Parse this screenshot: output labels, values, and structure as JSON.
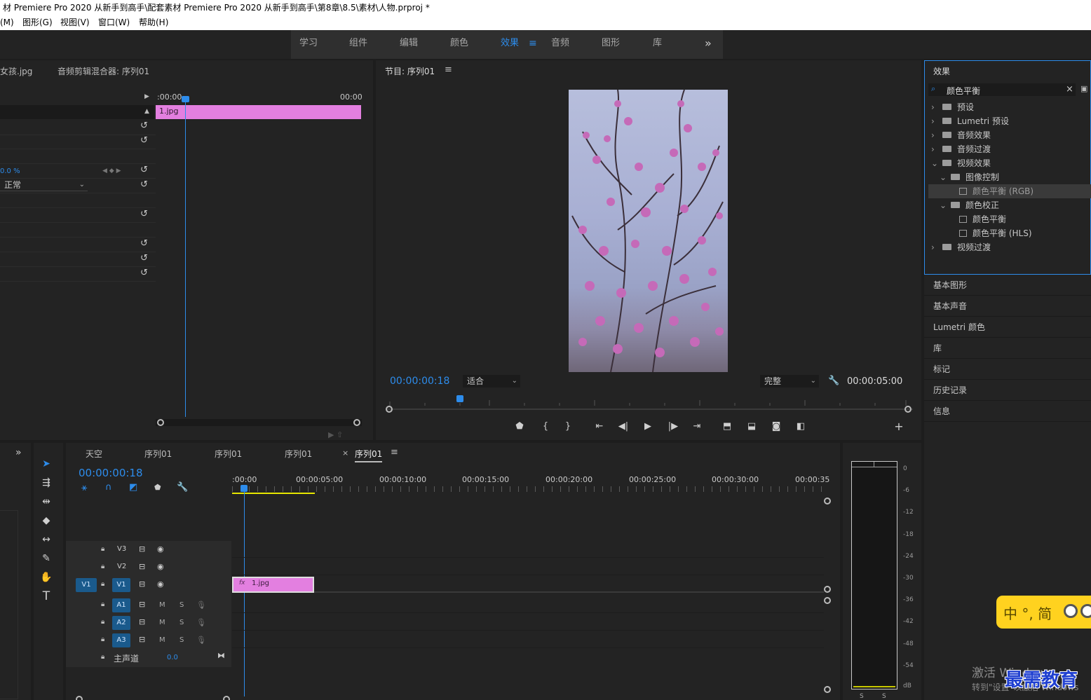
{
  "window": {
    "title": "材 Premiere Pro 2020 从新手到高手\\配套素材 Premiere Pro 2020 从新手到高手\\第8章\\8.5\\素材\\人物.prproj *"
  },
  "menu": [
    "(M)",
    "图形(G)",
    "视图(V)",
    "窗口(W)",
    "帮助(H)"
  ],
  "workspaces": {
    "tabs": [
      "学习",
      "组件",
      "编辑",
      "颜色",
      "效果",
      "音频",
      "图形",
      "库"
    ],
    "active": "效果",
    "overflow": "»"
  },
  "source_panel": {
    "tab_clip": "女孩.jpg",
    "tab_mixer": "音频剪辑混合器: 序列01",
    "ruler_start": ":00:00",
    "ruler_end": "00:00",
    "clip_label": "1.jpg",
    "opacity_value": "0.0 %",
    "blend_mode": "正常"
  },
  "program_monitor": {
    "title": "节目: 序列01",
    "timecode": "00:00:00:18",
    "fit": "适合",
    "quality": "完整",
    "duration": "00:00:05:00"
  },
  "effects_panel": {
    "title": "效果",
    "search_value": "颜色平衡",
    "tree": [
      {
        "label": "预设",
        "level": 0,
        "kind": "folder-star",
        "expanded": false
      },
      {
        "label": "Lumetri 预设",
        "level": 0,
        "kind": "folder-star",
        "expanded": false
      },
      {
        "label": "音频效果",
        "level": 0,
        "kind": "folder",
        "expanded": false
      },
      {
        "label": "音频过渡",
        "level": 0,
        "kind": "folder",
        "expanded": false
      },
      {
        "label": "视频效果",
        "level": 0,
        "kind": "folder",
        "expanded": true
      },
      {
        "label": "图像控制",
        "level": 1,
        "kind": "folder",
        "expanded": true
      },
      {
        "label": "颜色平衡 (RGB)",
        "level": 2,
        "kind": "effect",
        "selected": true
      },
      {
        "label": "颜色校正",
        "level": 1,
        "kind": "folder",
        "expanded": true
      },
      {
        "label": "颜色平衡",
        "level": 2,
        "kind": "effect"
      },
      {
        "label": "颜色平衡 (HLS)",
        "level": 2,
        "kind": "effect"
      },
      {
        "label": "视频过渡",
        "level": 0,
        "kind": "folder",
        "expanded": false
      }
    ]
  },
  "side_panels": [
    "基本图形",
    "基本声音",
    "Lumetri 颜色",
    "库",
    "标记",
    "历史记录",
    "信息"
  ],
  "timeline": {
    "tabs": [
      "天空",
      "序列01",
      "序列01",
      "序列01",
      "序列01"
    ],
    "active_tab_index": 4,
    "timecode": "00:00:00:18",
    "ruler": [
      ":00:00",
      "00:00:05:00",
      "00:00:10:00",
      "00:00:15:00",
      "00:00:20:00",
      "00:00:25:00",
      "00:00:30:00",
      "00:00:35"
    ],
    "video_tracks": [
      "V3",
      "V2",
      "V1"
    ],
    "audio_tracks": [
      "A1",
      "A2",
      "A3"
    ],
    "source_patch": "V1",
    "master_label": "主声道",
    "master_value": "0.0",
    "clip_label": "1.jpg",
    "clip_fx": "fx",
    "mute": "M",
    "solo": "S"
  },
  "vu_meter": {
    "ticks": [
      "0",
      "-6",
      "-12",
      "-18",
      "-24",
      "-30",
      "-36",
      "-42",
      "-48",
      "-54",
      "dB"
    ],
    "footer": [
      "S",
      "S"
    ]
  },
  "overlays": {
    "ime": "中 °, 简",
    "activate_line1": "激活 Windows",
    "activate_line2": "转到\"设置\"以激活 Windows",
    "watermark": "最需教育"
  },
  "colors": {
    "accent": "#2d8ceb",
    "clip": "#e37fe0",
    "panel": "#232323",
    "track_on": "#1a5a8c"
  }
}
